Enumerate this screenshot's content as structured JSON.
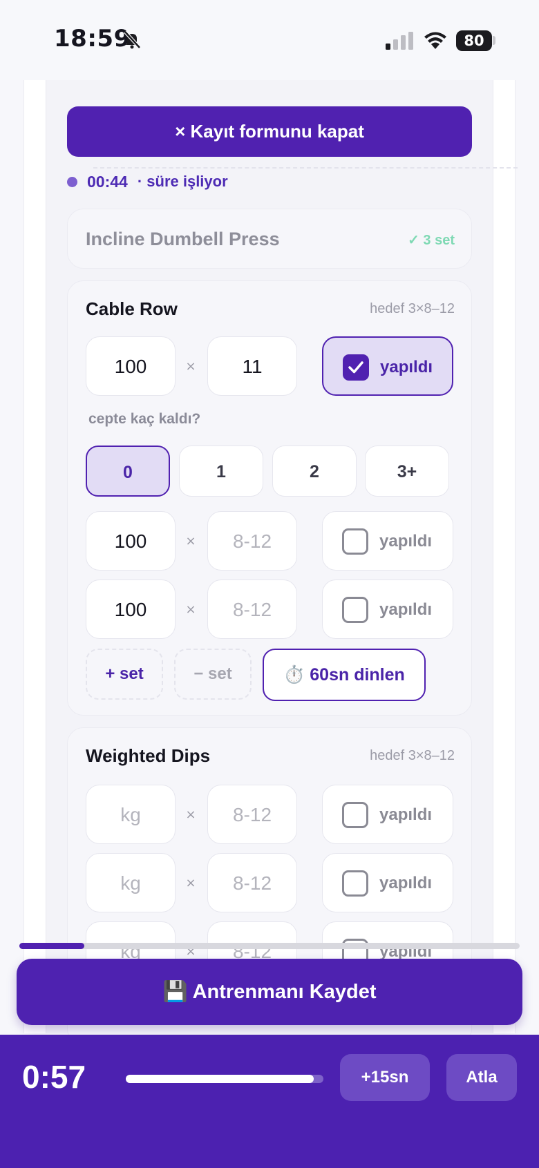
{
  "status_bar": {
    "time": "18:59",
    "battery": "80"
  },
  "close_form_label": "× Kayıt formunu kapat",
  "timer": {
    "elapsed": "00:44",
    "status": "· süre işliyor"
  },
  "completed_exercise": {
    "name": "Incline Dumbell Press",
    "badge": "✓ 3 set"
  },
  "cable_row": {
    "title": "Cable Row",
    "target": "hedef 3×8–12",
    "sets": [
      {
        "weight": "100",
        "reps": "11",
        "done": true,
        "done_label": "yapıldı"
      },
      {
        "weight": "100",
        "reps": "8-12",
        "done": false,
        "done_label": "yapıldı"
      },
      {
        "weight": "100",
        "reps": "8-12",
        "done": false,
        "done_label": "yapıldı"
      }
    ],
    "rir_question": "cepte kaç kaldı?",
    "rir_options": [
      "0",
      "1",
      "2",
      "3+"
    ],
    "rir_selected": "0",
    "add_set_label": "+ set",
    "remove_set_label": "− set",
    "rest_label": "⏱️ 60sn dinlen"
  },
  "weighted_dips": {
    "title": "Weighted Dips",
    "target": "hedef 3×8–12",
    "sets": [
      {
        "weight_placeholder": "kg",
        "reps_placeholder": "8-12",
        "done_label": "yapıldı"
      },
      {
        "weight_placeholder": "kg",
        "reps_placeholder": "8-12",
        "done_label": "yapıldı"
      },
      {
        "weight_placeholder": "kg",
        "reps_placeholder": "8-12",
        "done_label": "yapıldı"
      }
    ]
  },
  "times_symbol": "×",
  "workout_progress": 0.13,
  "save_button_label": "💾 Antrenmanı Kaydet",
  "rest_timer": {
    "remaining": "0:57",
    "progress": 0.95,
    "add_label": "+15sn",
    "skip_label": "Atla"
  },
  "colors": {
    "accent": "#5021b0",
    "selected_bg": "#e2dcf5",
    "success": "#7fd9b4"
  }
}
